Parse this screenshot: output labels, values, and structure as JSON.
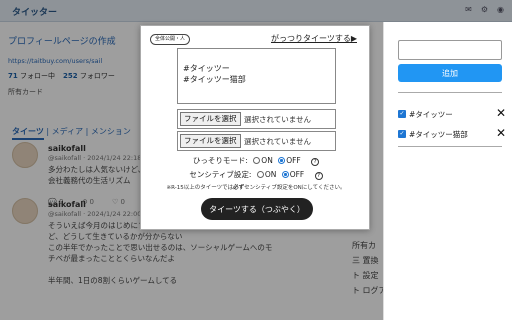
{
  "app": {
    "title": "タイッター",
    "top_icons": [
      "✉",
      "⚙",
      "◉"
    ]
  },
  "profile": {
    "edit_link": "プロフィールページの作成",
    "url": "https://taitbuy.com/users/sail",
    "following_count": "71",
    "following_label": "フォロー中",
    "followers_count": "252",
    "followers_label": "フォロワー",
    "owned_cards": "所有カード"
  },
  "tabs": [
    "タイーツ",
    "メディア",
    "メンション"
  ],
  "posts": [
    {
      "name": "saikofall",
      "meta": "@saikofall · 2024/1/24 22:18",
      "text": "多分わたしは人気ないけど、\n会社義務代の生活リズム",
      "actions": [
        "0",
        "0",
        "0"
      ]
    },
    {
      "name": "saikofall",
      "meta": "@saikofall · 2024/1/24 22:00",
      "text": "そういえば今月のはじめにフリーランスハブ(?)だったけ\nど、どうして生きているかが分からない\nこの半年でかったことで思い出せるのは、ソーシャルゲームへのモ\nチベが最まったこととくらいなんだよ\n\n半年間、1日の8割くらいゲームしてる",
      "actions": [
        "",
        "",
        ""
      ]
    }
  ],
  "right_menu": [
    "所有カ",
    "三 置換",
    "ト 設定",
    "ト ログアウ"
  ],
  "tag_panel": {
    "input_value": "",
    "add_label": "追加",
    "tags": [
      "#タイッツー",
      "#タイッツー猫部"
    ]
  },
  "modal": {
    "scope_label": "全体公開・人",
    "big_link": "がっつりタイーツする▶",
    "textarea_lines": [
      "#タイッツー",
      "#タイッツー猫部"
    ],
    "file_button_label": "ファイルを選択",
    "file_status": "選択されていません",
    "secret_mode_label": "ひっそりモード:",
    "sensitive_label": "センシティブ設定:",
    "on_label": "ON",
    "off_label": "OFF",
    "help_icon": "?",
    "note_prefix": "※R-15以上のタイーツでは",
    "note_strong": "必ず",
    "note_suffix": "センシティブ設定をONにしてください。",
    "submit_label": "タイーツする（つぶやく）"
  }
}
